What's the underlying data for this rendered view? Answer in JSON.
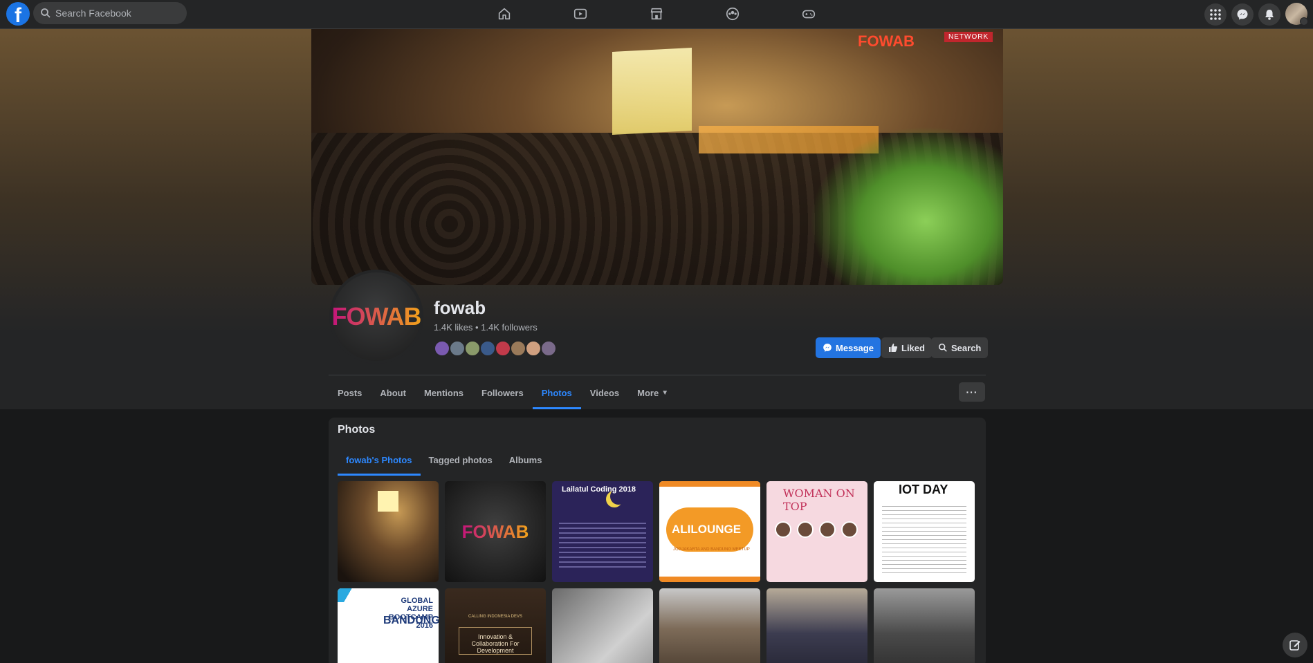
{
  "topbar": {
    "logo": "f",
    "search_placeholder": "Search Facebook",
    "nav_icons": [
      "home-icon",
      "video-icon",
      "marketplace-icon",
      "groups-icon",
      "gaming-icon"
    ],
    "right_icons": [
      "menu-grid-icon",
      "messenger-icon",
      "notifications-icon"
    ]
  },
  "cover": {
    "banner_text": "FOWAB",
    "network_text": "NETWORK"
  },
  "profile": {
    "logo_text": "FOWAB",
    "name": "fowab",
    "stats": "1.4K likes • 1.4K followers"
  },
  "actions": {
    "message": "Message",
    "liked": "Liked",
    "search": "Search",
    "more_dots": "···"
  },
  "tabs": [
    {
      "label": "Posts",
      "active": false
    },
    {
      "label": "About",
      "active": false
    },
    {
      "label": "Mentions",
      "active": false
    },
    {
      "label": "Followers",
      "active": false
    },
    {
      "label": "Photos",
      "active": true
    },
    {
      "label": "Videos",
      "active": false
    },
    {
      "label": "More",
      "active": false
    }
  ],
  "photos": {
    "title": "Photos",
    "subtabs": [
      "fowab's Photos",
      "Tagged photos",
      "Albums"
    ],
    "thumbs": {
      "t2": "FOWAB",
      "t3": "Lailatul Coding 2018",
      "t4": "ALILOUNGE",
      "t4_sub": "JOGJAKARTA AND BANDUNG MEETUP",
      "t5": "WOMAN ON TOP",
      "t6": "IOT DAY",
      "t7_head": "GLOBAL AZURE BOOTCAMP 2016",
      "t7_big": "BANDUNG",
      "t8_head": "CALLING INDONESIA DEVS",
      "t8_box": "Innovation & Collaboration For Development"
    }
  },
  "colors": {
    "accent": "#2d88ff",
    "button_primary": "#2374e1",
    "background": "#18191a",
    "surface": "#242526"
  }
}
